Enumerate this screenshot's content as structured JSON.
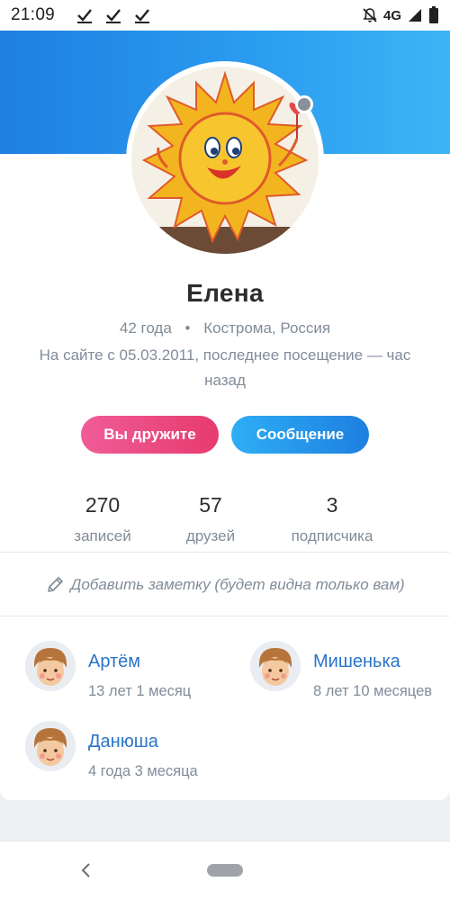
{
  "status_bar": {
    "time": "21:09",
    "notification_icons": [
      "check-icon",
      "check-icon",
      "check-icon"
    ],
    "right_icons": [
      "notifications-off-icon",
      "signal-icon",
      "battery-icon"
    ],
    "network": "4G"
  },
  "profile": {
    "name": "Елена",
    "age": "42 года",
    "location": "Кострома, Россия",
    "last_seen": "На сайте с 05.03.2011, последнее посещение — час назад",
    "online_status_color": "#8a9099"
  },
  "buttons": {
    "friends": "Вы дружите",
    "message": "Сообщение"
  },
  "counters": [
    {
      "value": "270",
      "label": "записей"
    },
    {
      "value": "57",
      "label": "друзей"
    },
    {
      "value": "3",
      "label": "подписчика"
    }
  ],
  "note": {
    "text": "Добавить заметку (будет видна только вам)"
  },
  "children": [
    {
      "name": "Артём",
      "age": "13 лет 1 месяц"
    },
    {
      "name": "Мишенька",
      "age": "8 лет 10 месяцев"
    },
    {
      "name": "Данюша",
      "age": "4 года 3 месяца"
    }
  ],
  "colors": {
    "accent_blue": "#1e7fe0",
    "friends_button": "#e63b6f",
    "link": "#2a74c9",
    "secondary_text": "#818c99"
  }
}
